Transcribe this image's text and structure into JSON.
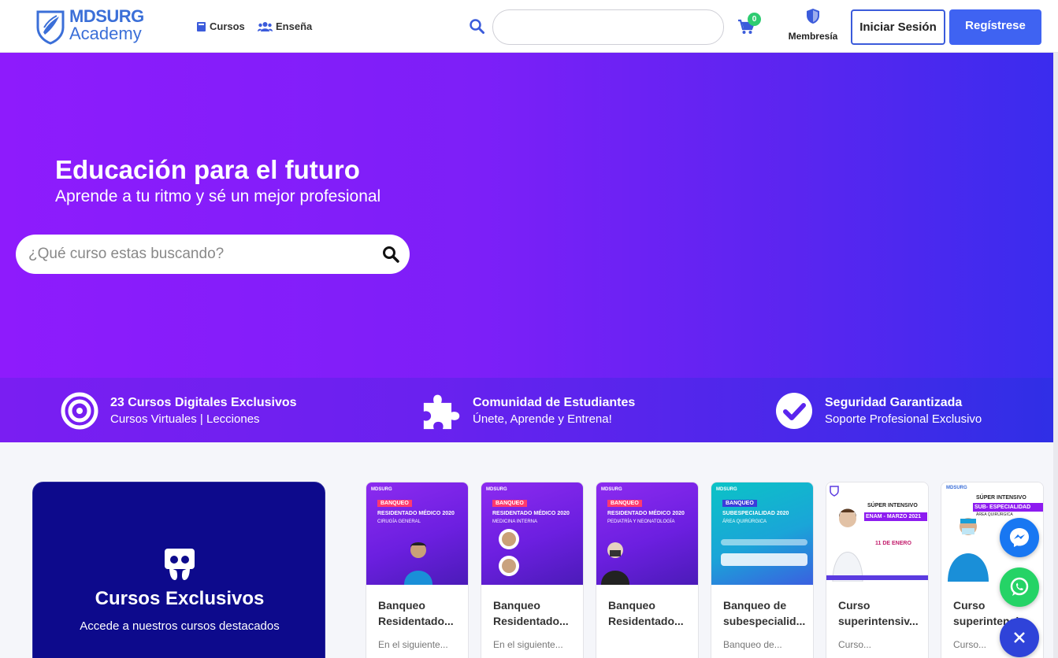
{
  "brand": {
    "name_line1": "MDSURG",
    "name_line2": "Academy",
    "accent": "#3f63f2"
  },
  "nav": {
    "links": [
      {
        "label": "Cursos",
        "icon": "book-icon"
      },
      {
        "label": "Enseña",
        "icon": "users-icon"
      }
    ],
    "search": {
      "placeholder": ""
    },
    "cart_count": "0",
    "membership_label": "Membresía",
    "login_label": "Iniciar Sesión",
    "register_label": "Regístrese"
  },
  "hero": {
    "title": "Educación para el futuro",
    "subtitle": "Aprende a tu ritmo y sé un mejor profesional",
    "search_placeholder": "¿Qué curso estas buscando?",
    "gradient": [
      "#8e1bfc",
      "#3a2cee"
    ]
  },
  "features": [
    {
      "icon": "target-icon",
      "title": "23 Cursos Digitales Exclusivos",
      "subtitle": "Cursos Virtuales | Lecciones"
    },
    {
      "icon": "puzzle-icon",
      "title": "Comunidad de Estudiantes",
      "subtitle": "Únete, Aprende y Entrena!"
    },
    {
      "icon": "check-circle-icon",
      "title": "Seguridad Garantizada",
      "subtitle": "Soporte Profesional Exclusivo"
    }
  ],
  "exclusive": {
    "icon": "slideshare-icon",
    "title": "Cursos Exclusivos",
    "subtitle": "Accede a nuestros cursos destacados"
  },
  "courses": [
    {
      "title_l1": "Banqueo",
      "title_l2": "Residentado...",
      "desc": "En el siguiente...",
      "thumb": {
        "tag": "BANQUEO",
        "heading": "RESIDENTADO MÉDICO 2020",
        "sub": "CIRUGÍA GENERAL"
      }
    },
    {
      "title_l1": "Banqueo",
      "title_l2": "Residentado...",
      "desc": "En el siguiente...",
      "thumb": {
        "tag": "BANQUEO",
        "heading": "RESIDENTADO MÉDICO 2020",
        "sub": "MEDICINA INTERNA"
      }
    },
    {
      "title_l1": "Banqueo",
      "title_l2": "Residentado...",
      "desc": "",
      "thumb": {
        "tag": "BANQUEO",
        "heading": "RESIDENTADO MÉDICO 2020",
        "sub": "PEDIATRÍA Y NEONATOLOGÍA"
      }
    },
    {
      "title_l1": "Banqueo de",
      "title_l2": "subespecialid...",
      "desc": "Banqueo de...",
      "thumb": {
        "tag": "BANQUEO",
        "heading": "SUBESPECIALIDAD 2020",
        "sub": "ÁREA QUIRÚRGICA"
      }
    },
    {
      "title_l1": "Curso",
      "title_l2": "superintensiv...",
      "desc": "Curso...",
      "thumb": {
        "tag": "SÚPER INTENSIVO",
        "heading": "ENAM - MARZO 2021",
        "sub": "11 DE ENERO"
      }
    },
    {
      "title_l1": "Curso",
      "title_l2": "superintensiv...",
      "desc": "Curso...",
      "thumb": {
        "tag": "SÚPER INTENSIVO",
        "heading": "SUB- ESPECIALIDAD",
        "sub": "ÁREA QUIRÚRGICA"
      }
    }
  ]
}
